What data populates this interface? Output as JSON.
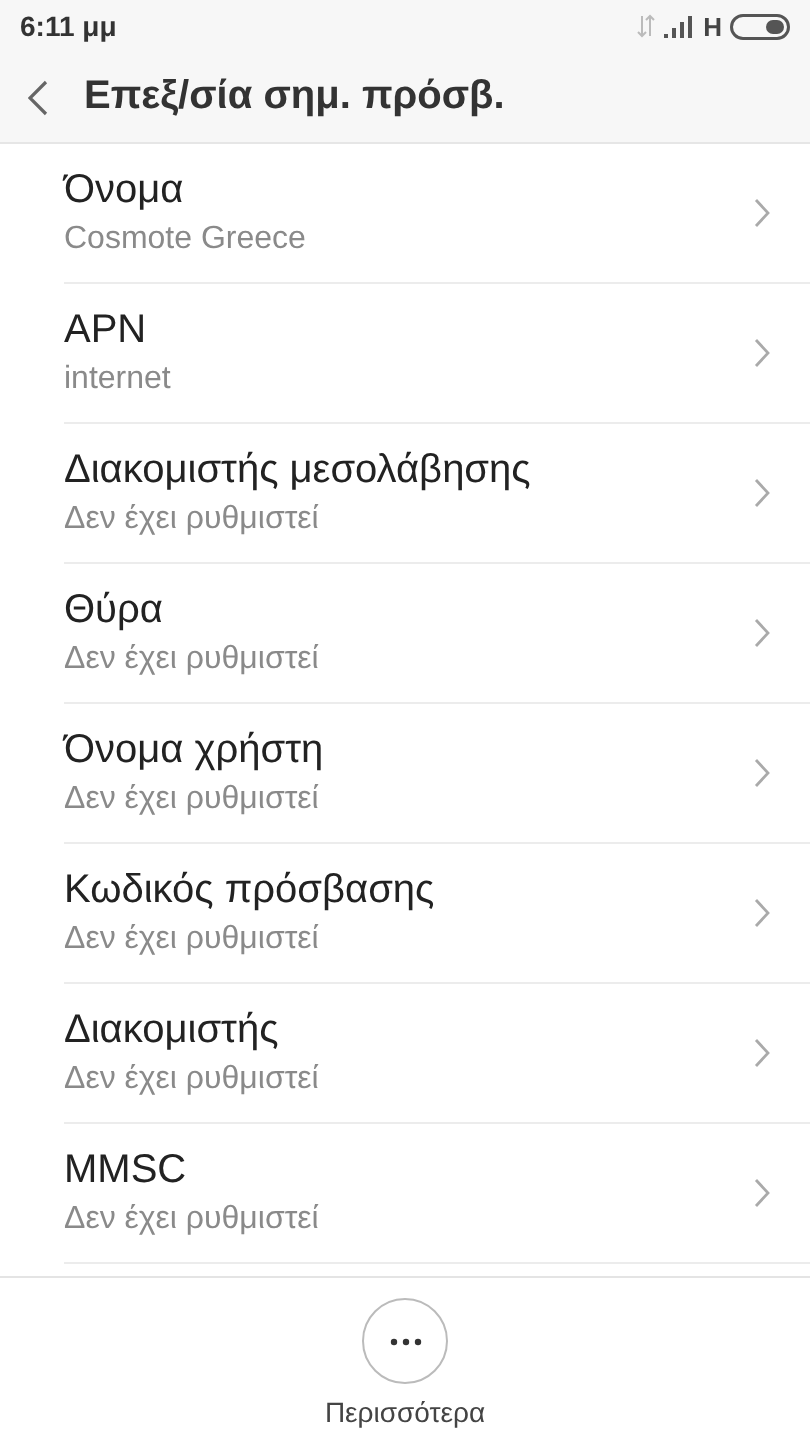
{
  "status_bar": {
    "time": "6:11 μμ",
    "network": "H"
  },
  "header": {
    "title": "Επεξ/σία σημ. πρόσβ."
  },
  "items": [
    {
      "title": "Όνομα",
      "value": "Cosmote Greece"
    },
    {
      "title": "APN",
      "value": "internet"
    },
    {
      "title": "Διακομιστής μεσολάβησης",
      "value": "Δεν έχει ρυθμιστεί"
    },
    {
      "title": "Θύρα",
      "value": "Δεν έχει ρυθμιστεί"
    },
    {
      "title": "Όνομα χρήστη",
      "value": "Δεν έχει ρυθμιστεί"
    },
    {
      "title": "Κωδικός πρόσβασης",
      "value": "Δεν έχει ρυθμιστεί"
    },
    {
      "title": "Διακομιστής",
      "value": "Δεν έχει ρυθμιστεί"
    },
    {
      "title": "MMSC",
      "value": "Δεν έχει ρυθμιστεί"
    }
  ],
  "bottom_bar": {
    "more_label": "Περισσότερα"
  }
}
